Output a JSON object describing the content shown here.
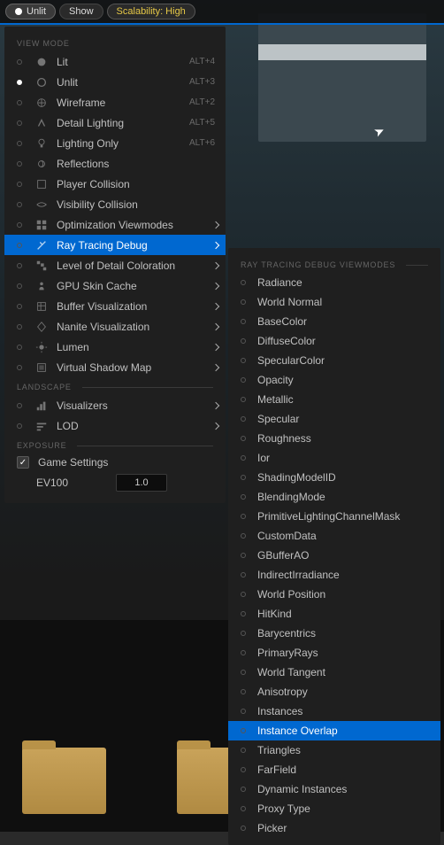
{
  "toolbar": {
    "unlit": "Unlit",
    "show": "Show",
    "scalability": "Scalability: High"
  },
  "panel": {
    "viewmode_header": "VIEW MODE",
    "landscape_header": "LANDSCAPE",
    "exposure_header": "EXPOSURE",
    "items": [
      {
        "label": "Lit",
        "shortcut": "ALT+4",
        "icon": "lit"
      },
      {
        "label": "Unlit",
        "shortcut": "ALT+3",
        "selected": true,
        "icon": "unlit"
      },
      {
        "label": "Wireframe",
        "shortcut": "ALT+2",
        "icon": "wireframe"
      },
      {
        "label": "Detail Lighting",
        "shortcut": "ALT+5",
        "icon": "detail"
      },
      {
        "label": "Lighting Only",
        "shortcut": "ALT+6",
        "icon": "bulb"
      },
      {
        "label": "Reflections",
        "icon": "reflect"
      },
      {
        "label": "Player Collision",
        "icon": "collision"
      },
      {
        "label": "Visibility Collision",
        "icon": "visibility"
      },
      {
        "label": "Optimization Viewmodes",
        "chevron": true,
        "icon": "opt"
      },
      {
        "label": "Ray Tracing Debug",
        "chevron": true,
        "highlighted": true,
        "icon": "ray"
      },
      {
        "label": "Level of Detail Coloration",
        "chevron": true,
        "icon": "lod"
      },
      {
        "label": "GPU Skin Cache",
        "chevron": true,
        "icon": "gpu"
      },
      {
        "label": "Buffer Visualization",
        "chevron": true,
        "icon": "buffer"
      },
      {
        "label": "Nanite Visualization",
        "chevron": true,
        "icon": "nanite"
      },
      {
        "label": "Lumen",
        "chevron": true,
        "icon": "lumen"
      },
      {
        "label": "Virtual Shadow Map",
        "chevron": true,
        "icon": "vsm"
      }
    ],
    "landscape_items": [
      {
        "label": "Visualizers",
        "chevron": true,
        "icon": "vis"
      },
      {
        "label": "LOD",
        "chevron": true,
        "icon": "lodl"
      }
    ],
    "game_settings": "Game Settings",
    "ev100_label": "EV100",
    "ev100_value": "1.0"
  },
  "submenu": {
    "header": "RAY TRACING DEBUG VIEWMODES",
    "items": [
      {
        "label": "Radiance"
      },
      {
        "label": "World Normal"
      },
      {
        "label": "BaseColor"
      },
      {
        "label": "DiffuseColor"
      },
      {
        "label": "SpecularColor"
      },
      {
        "label": "Opacity"
      },
      {
        "label": "Metallic"
      },
      {
        "label": "Specular"
      },
      {
        "label": "Roughness"
      },
      {
        "label": "Ior"
      },
      {
        "label": "ShadingModelID"
      },
      {
        "label": "BlendingMode"
      },
      {
        "label": "PrimitiveLightingChannelMask"
      },
      {
        "label": "CustomData"
      },
      {
        "label": "GBufferAO"
      },
      {
        "label": "IndirectIrradiance"
      },
      {
        "label": "World Position"
      },
      {
        "label": "HitKind"
      },
      {
        "label": "Barycentrics"
      },
      {
        "label": "PrimaryRays"
      },
      {
        "label": "World Tangent"
      },
      {
        "label": "Anisotropy"
      },
      {
        "label": "Instances"
      },
      {
        "label": "Instance Overlap",
        "highlighted": true
      },
      {
        "label": "Triangles"
      },
      {
        "label": "FarField"
      },
      {
        "label": "Dynamic Instances"
      },
      {
        "label": "Proxy Type"
      },
      {
        "label": "Picker"
      }
    ]
  }
}
